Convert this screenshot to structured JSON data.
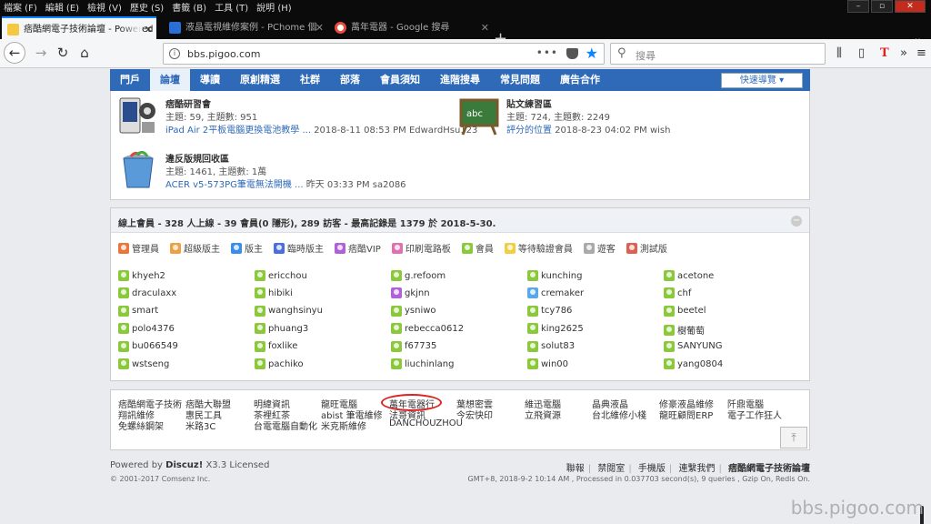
{
  "menubar": {
    "items": [
      "檔案 (F)",
      "編輯 (E)",
      "檢視 (V)",
      "歷史 (S)",
      "書籤 (B)",
      "工具 (T)",
      "說明 (H)"
    ]
  },
  "tabs": [
    {
      "title": "痞酷網電子技術論壇 - Powered b",
      "color": "#f5c842"
    },
    {
      "title": "液晶電視維修案例 - PChome 個",
      "color": "#2a6ed8"
    },
    {
      "title": "萬年電器 - Google 搜尋",
      "color": "#e84c3d"
    }
  ],
  "navbar": {
    "url": "bbs.pigoo.com",
    "search_placeholder": "搜尋",
    "dots": "•••"
  },
  "mainnav": {
    "items": [
      "門戶",
      "論壇",
      "導讀",
      "原創精選",
      "社群",
      "部落",
      "會員須知",
      "進階搜尋",
      "常見問題",
      "廣告合作"
    ],
    "quick_nav": "快速導覽 ▾"
  },
  "forums": [
    {
      "name": "痞酷研習會",
      "stats": "主題: 59, 主題數: 951",
      "last_link": "iPad Air 2平板電腦更換電池教學 ...",
      "last_meta": "2018-8-11 08:53 PM EdwardHsu123"
    },
    {
      "name": "貼文練習區",
      "stats": "主題: 724, 主題數: 2249",
      "last_link": "評分的位置",
      "last_meta": "2018-8-23 04:02 PM wish"
    },
    {
      "name": "違反版規回收區",
      "stats": "主題: 1461, 主題數: 1萬",
      "last_link": "ACER v5-573PG筆電無法開機 ...",
      "last_meta": "昨天 03:33 PM sa2086"
    }
  ],
  "online": {
    "title": "線上會員 - 328 人上線 - 39 會員(0 隱形), 289 訪客 - 最高記錄是 1379 於 2018-5-30.",
    "collapse": "−",
    "legend": [
      {
        "label": "管理員",
        "color": "#e8773a"
      },
      {
        "label": "超級版主",
        "color": "#f0a040"
      },
      {
        "label": "版主",
        "color": "#3a8ee8"
      },
      {
        "label": "臨時版主",
        "color": "#4a6ee0"
      },
      {
        "label": "痞酷VIP",
        "color": "#b060d8"
      },
      {
        "label": "印刷電路板",
        "color": "#e070b0"
      },
      {
        "label": "會員",
        "color": "#8cc83c"
      },
      {
        "label": "等待驗證會員",
        "color": "#f0d040"
      },
      {
        "label": "遊客",
        "color": "#aaaaaa"
      },
      {
        "label": "測試版",
        "color": "#e06050"
      }
    ],
    "users": [
      [
        "khyeh2",
        "ericchou",
        "g.refoom",
        "kunching",
        "acetone"
      ],
      [
        "draculaxx",
        "hibiki",
        "gkjnn",
        "cremaker",
        "chf"
      ],
      [
        "smart",
        "wanghsinyu",
        "ysniwo",
        "tcy786",
        "beetel"
      ],
      [
        "polo4376",
        "phuang3",
        "rebecca0612",
        "king2625",
        "樹葡萄"
      ],
      [
        "bu066549",
        "foxlike",
        "f67735",
        "solut83",
        "SANYUNG"
      ],
      [
        "wstseng",
        "pachiko",
        "liuchinlang",
        "win00",
        "yang0804"
      ]
    ],
    "user_colors": [
      [
        "#8cc83c",
        "#8cc83c",
        "#8cc83c",
        "#8cc83c",
        "#8cc83c"
      ],
      [
        "#8cc83c",
        "#8cc83c",
        "#b060d8",
        "#5aa8e8",
        "#8cc83c"
      ],
      [
        "#8cc83c",
        "#8cc83c",
        "#8cc83c",
        "#8cc83c",
        "#8cc83c"
      ],
      [
        "#8cc83c",
        "#8cc83c",
        "#8cc83c",
        "#8cc83c",
        "#8cc83c"
      ],
      [
        "#8cc83c",
        "#8cc83c",
        "#8cc83c",
        "#8cc83c",
        "#8cc83c"
      ],
      [
        "#8cc83c",
        "#8cc83c",
        "#8cc83c",
        "#8cc83c",
        "#8cc83c"
      ]
    ]
  },
  "links": [
    [
      "痞酷網電子技術",
      "痞酷大聯盟",
      "明緯資訊",
      "龍旺電腦",
      "萬年電器行",
      "葉想密雲",
      "維迅電腦",
      "晶典液晶",
      "修豪液晶維修",
      "阡鼎電腦"
    ],
    [
      "翔訊維修",
      "惠民工具",
      "茶裡紅茶",
      "abist 筆電維修",
      "法哥資訊",
      "今宏快印",
      "立飛資源",
      "台北維修小棧",
      "龍旺顧問ERP",
      "電子工作狂人"
    ],
    [
      "免螺絲鋼架",
      "米路3C",
      "台電電腦自動化",
      "米克斯維修",
      "DANCHOUZHOU"
    ]
  ],
  "footer": {
    "powered_prefix": "Powered by",
    "powered_brand": "Discuz!",
    "powered_suffix": "X3.3 Licensed",
    "copyright": "© 2001-2017 Comsenz Inc.",
    "links": [
      "聯報",
      "禁閱室",
      "手機版",
      "連繫我們",
      "痞酷網電子技術論壇"
    ],
    "debug": "GMT+8, 2018-9-2 10:14 AM , Processed in 0.037703 second(s), 9 queries , Gzip On, Redis On."
  },
  "watermark": "bbs.pigoo.com",
  "to_top": "⤒",
  "window_controls": [
    "–",
    "▫",
    "✕"
  ]
}
